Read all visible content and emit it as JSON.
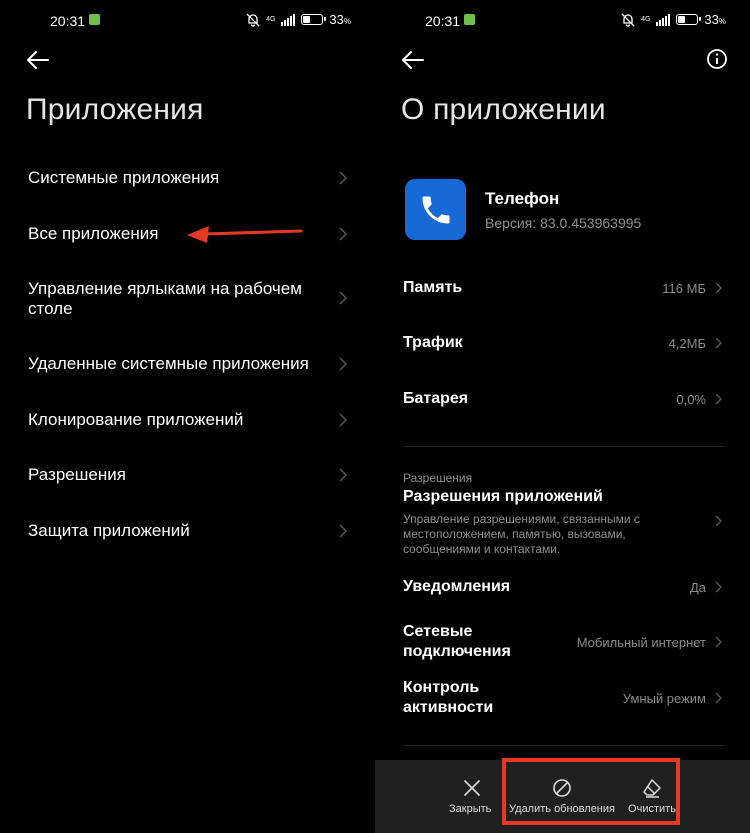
{
  "left": {
    "status": {
      "time": "20:31",
      "net": "4G",
      "battery": "33",
      "battery_unit": "%",
      "battery_level": 0.33
    },
    "title": "Приложения",
    "items": [
      {
        "label": "Системные приложения"
      },
      {
        "label": "Все приложения"
      },
      {
        "label": "Управление ярлыками на рабочем столе"
      },
      {
        "label": "Удаленные системные приложения"
      },
      {
        "label": "Клонирование приложений"
      },
      {
        "label": "Разрешения"
      },
      {
        "label": "Защита приложений"
      }
    ],
    "annotation_color": "#e53925"
  },
  "right": {
    "status": {
      "time": "20:31",
      "net": "4G",
      "battery": "33",
      "battery_unit": "%",
      "battery_level": 0.33
    },
    "title": "О приложении",
    "app": {
      "name": "Телефон",
      "version": "Версия: 83.0.453963995",
      "icon": "phone-icon",
      "icon_color": "#1769d6"
    },
    "stats": [
      {
        "label": "Память",
        "value": "116 МБ"
      },
      {
        "label": "Трафик",
        "value": "4,2МБ"
      },
      {
        "label": "Батарея",
        "value": "0,0%"
      }
    ],
    "permissions": {
      "caption": "Разрешения",
      "title": "Разрешения приложений",
      "desc": "Управление разрешениями, связанными с местоположением, памятью, вызовами, сообщениями и контактами."
    },
    "settings": [
      {
        "label": "Уведомления",
        "value": "Да"
      },
      {
        "label": "Сетевые подключения",
        "value": "Мобильный интернет"
      },
      {
        "label": "Контроль активности",
        "value": "Умный режим"
      }
    ],
    "bottom": {
      "close": "Закрыть",
      "uninstall_updates": "Удалить обновления",
      "clear": "Очистить"
    },
    "highlight_color": "#e53925"
  }
}
